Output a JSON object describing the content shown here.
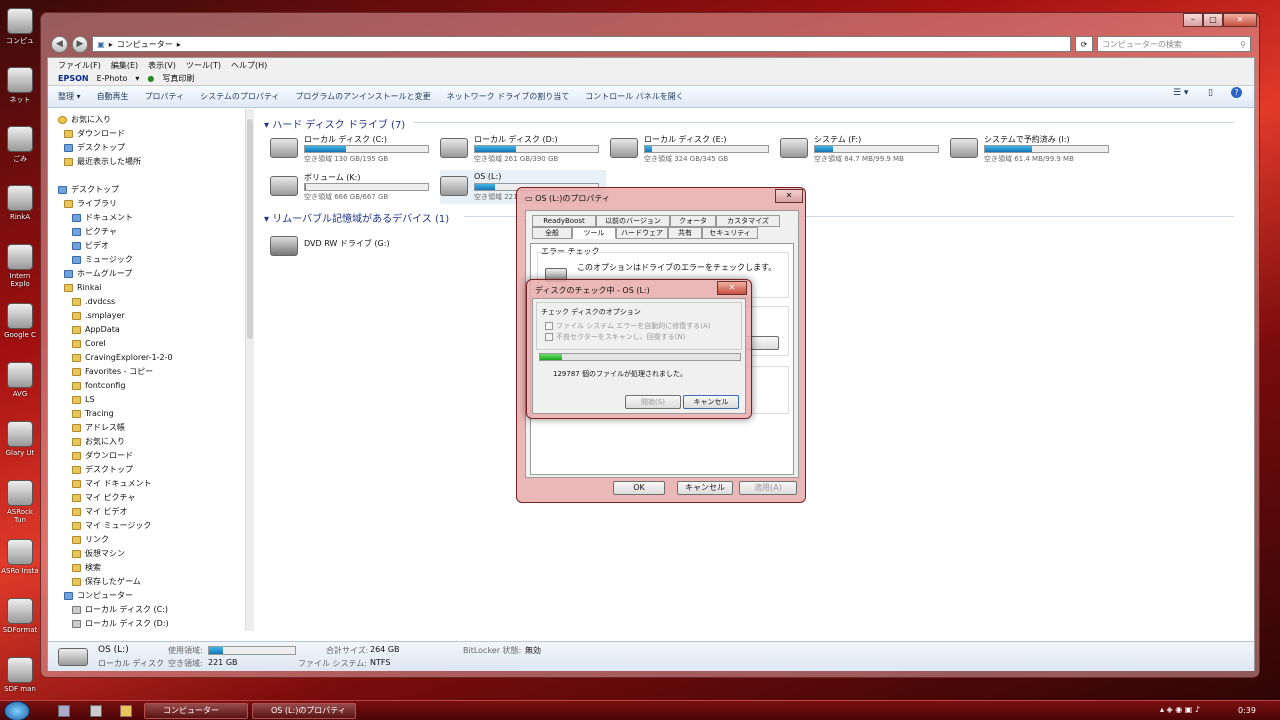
{
  "desktop_icons": [
    "コンピュ",
    "ネット",
    "ごみ",
    "RinkA",
    "Intern Explo",
    "Google C",
    "AVG",
    "Glary Ut",
    "ASRock Tun",
    "ASRo Insta",
    "SDFormat",
    "SDF man"
  ],
  "window": {
    "breadcrumb": "コンピューター",
    "search_placeholder": "コンピューターの検索",
    "menu": [
      "ファイル(F)",
      "編集(E)",
      "表示(V)",
      "ツール(T)",
      "ヘルプ(H)"
    ],
    "epson": {
      "brand": "EPSON",
      "app": "E-Photo",
      "link": "写真印刷"
    },
    "commands": [
      "整理 ▾",
      "自動再生",
      "プロパティ",
      "システムのプロパティ",
      "プログラムのアンインストールと変更",
      "ネットワーク ドライブの割り当て",
      "コントロール パネルを開く"
    ],
    "nav": {
      "favorites": "お気に入り",
      "favorites_items": [
        "ダウンロード",
        "デスクトップ",
        "最近表示した場所"
      ],
      "desktop": "デスクトップ",
      "library": "ライブラリ",
      "library_items": [
        "ドキュメント",
        "ピクチャ",
        "ビデオ",
        "ミュージック"
      ],
      "homegroup": "ホームグループ",
      "user": "Rinkai",
      "user_items": [
        ".dvdcss",
        ".smplayer",
        "AppData",
        "Corel",
        "CravingExplorer-1-2-0",
        "Favorites - コピー",
        "fontconfig",
        "LS",
        "Tracing",
        "アドレス帳",
        "お気に入り",
        "ダウンロード",
        "デスクトップ",
        "マイ ドキュメント",
        "マイ ピクチャ",
        "マイ ビデオ",
        "マイ ミュージック",
        "リンク",
        "仮想マシン",
        "検索",
        "保存したゲーム"
      ],
      "computer": "コンピューター",
      "computer_items": [
        "ローカル ディスク (C:)",
        "ローカル ディスク (D:)"
      ]
    },
    "hdd_section": "ハード ディスク ドライブ (7)",
    "drives": [
      {
        "name": "ローカル ディスク (C:)",
        "free": "空き領域 130 GB/195 GB",
        "used": 0.33
      },
      {
        "name": "ローカル ディスク (D:)",
        "free": "空き領域 261 GB/390 GB",
        "used": 0.33
      },
      {
        "name": "ローカル ディスク (E:)",
        "free": "空き領域 324 GB/345 GB",
        "used": 0.06
      },
      {
        "name": "システム (F:)",
        "free": "空き領域 84.7 MB/99.9 MB",
        "used": 0.15
      },
      {
        "name": "システムで予約済み (I:)",
        "free": "空き領域 61.4 MB/99.9 MB",
        "used": 0.38
      },
      {
        "name": "ボリューム (K:)",
        "free": "空き領域 666 GB/667 GB",
        "used": 0.01
      },
      {
        "name": "OS (L:)",
        "free": "空き領域 221",
        "used": 0.16
      }
    ],
    "removable_section": "リムーバブル記憶域があるデバイス (1)",
    "dvd": "DVD RW ドライブ (G:)",
    "status": {
      "name": "OS (L:)",
      "type": "ローカル ディスク",
      "used_label": "使用領域:",
      "free_label": "空き領域:",
      "free": "221 GB",
      "total_label": "合計サイズ:",
      "total": "264 GB",
      "fs_label": "ファイル システム:",
      "fs": "NTFS",
      "bitlocker_label": "BitLocker 状態:",
      "bitlocker": "無効",
      "used": 0.16
    }
  },
  "props": {
    "title": "OS (L:)のプロパティ",
    "tabs_row1": [
      "ReadyBoost",
      "以前のバージョン",
      "クォータ",
      "カスタマイズ"
    ],
    "tabs_row2": [
      "全般",
      "ツール",
      "ハードウェア",
      "共有",
      "セキュリティ"
    ],
    "error_group": "エラー チェック",
    "error_text": "このオプションはドライブのエラーをチェックします。",
    "ok": "OK",
    "cancel": "キャンセル",
    "apply": "適用(A)"
  },
  "check": {
    "title": "ディスクのチェック中 - OS (L:)",
    "group": "チェック ディスクのオプション",
    "opt1": "ファイル システム エラーを自動的に修復する(A)",
    "opt2": "不良セクターをスキャンし、回復する(N)",
    "progress": 0.11,
    "files": "129787 個のファイルが処理されました。",
    "start": "開始(S)",
    "cancel": "キャンセル"
  },
  "taskbar": {
    "items": [
      "コンピューター",
      "OS (L:)のプロパティ"
    ],
    "time": "0:39"
  }
}
